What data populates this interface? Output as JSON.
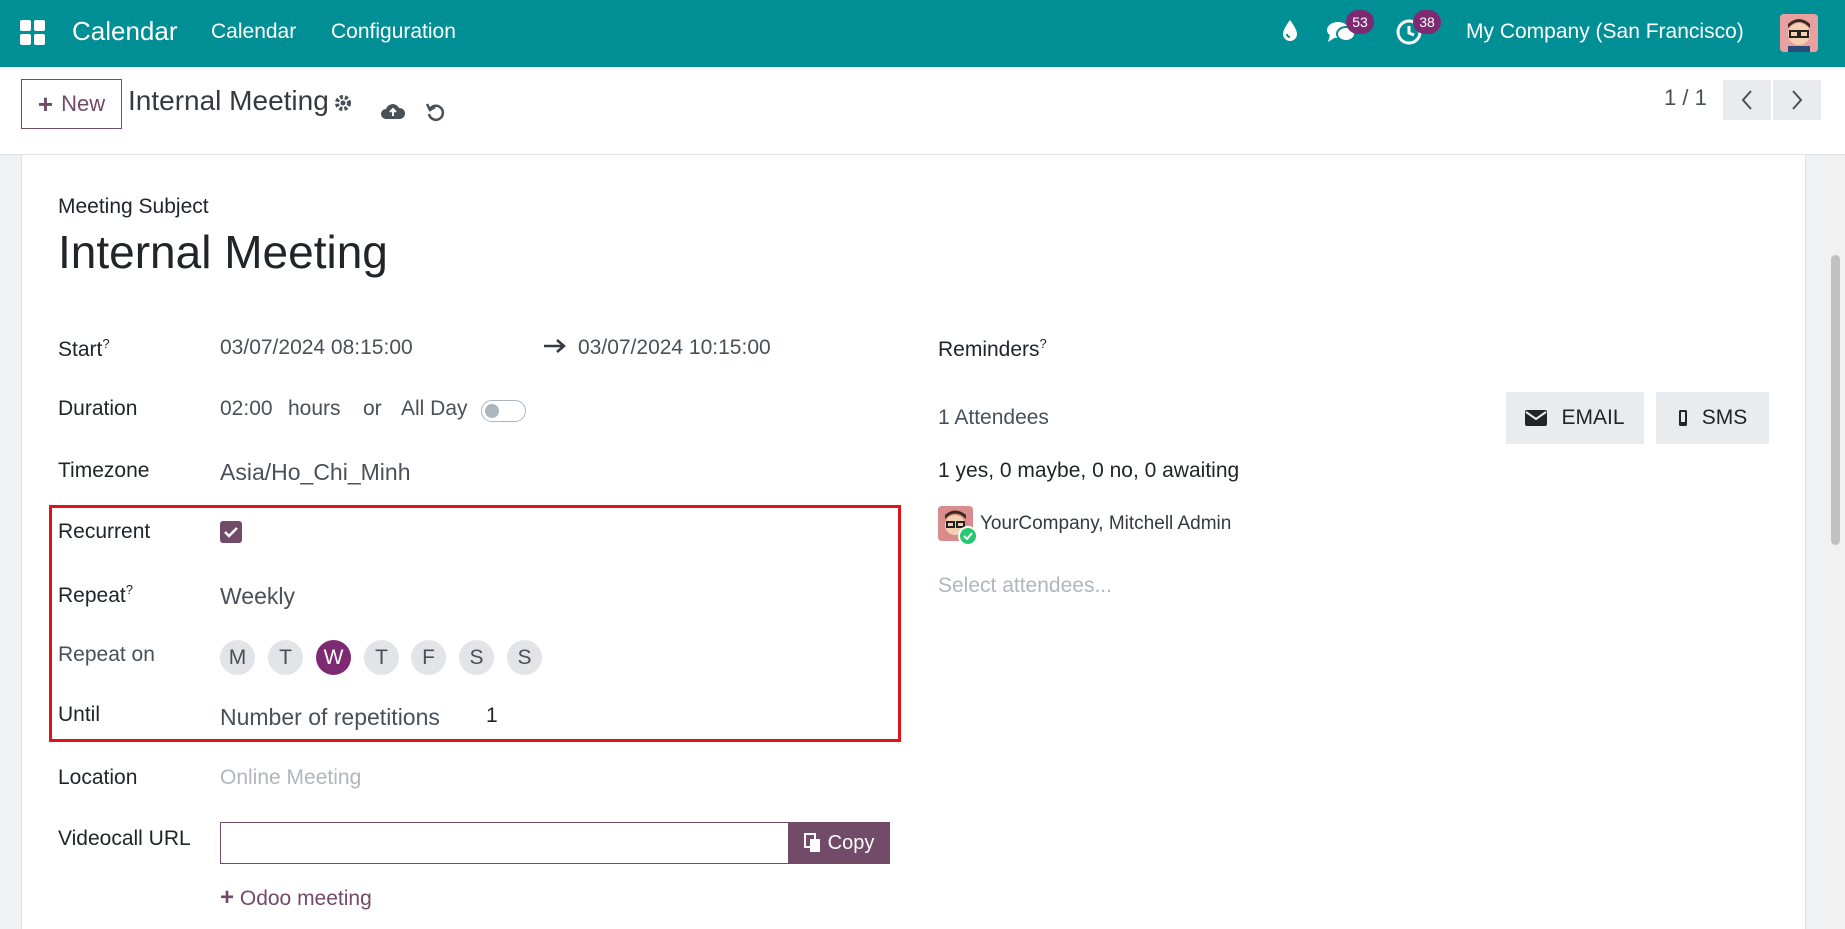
{
  "navbar": {
    "app_name": "Calendar",
    "menu": [
      "Calendar",
      "Configuration"
    ],
    "messages_count": "53",
    "activities_count": "38",
    "company": "My Company (San Francisco)"
  },
  "control": {
    "new_label": "New",
    "record_title": "Internal Meeting",
    "pager": "1 / 1"
  },
  "form": {
    "subject_label": "Meeting Subject",
    "subject": "Internal Meeting",
    "start_label": "Start",
    "help_mark": "?",
    "start": "03/07/2024 08:15:00",
    "stop": "03/07/2024 10:15:00",
    "duration_label": "Duration",
    "duration": "02:00",
    "hours_label": "hours",
    "or_label": "or",
    "allday_label": "All Day",
    "timezone_label": "Timezone",
    "timezone": "Asia/Ho_Chi_Minh",
    "recurrent_label": "Recurrent",
    "repeat_label": "Repeat",
    "repeat": "Weekly",
    "repeat_on_label": "Repeat on",
    "days": [
      "M",
      "T",
      "W",
      "T",
      "F",
      "S",
      "S"
    ],
    "until_label": "Until",
    "until": "Number of repetitions",
    "count": "1",
    "location_label": "Location",
    "location_placeholder": "Online Meeting",
    "videocall_label": "Videocall URL",
    "copy_label": "Copy",
    "odoo_meeting_label": "Odoo meeting",
    "reminders_label": "Reminders",
    "attendees_count": "1 Attendees",
    "email_label": "EMAIL",
    "sms_label": "SMS",
    "attendees_summary": "1 yes, 0 maybe, 0 no, 0 awaiting",
    "attendee_name": "YourCompany, Mitchell Admin",
    "select_attendees_placeholder": "Select attendees..."
  },
  "colors": {
    "navbar": "#018f96",
    "primary": "#714b67",
    "badge": "#7e2a73",
    "highlight": "#e0131b"
  }
}
